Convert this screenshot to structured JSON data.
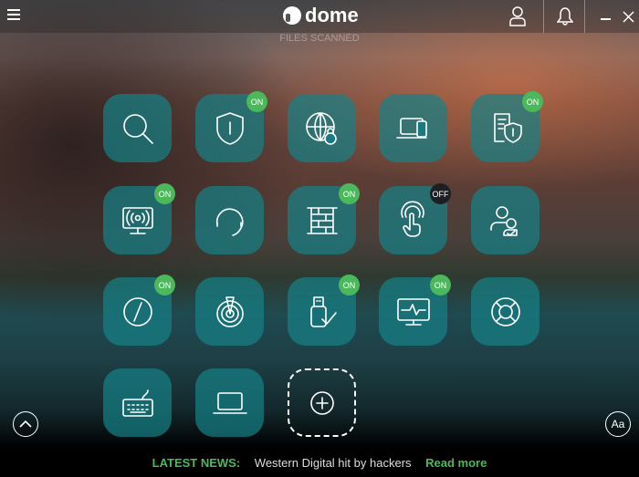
{
  "app": {
    "name": "dome",
    "menu_icon": "hamburger-icon"
  },
  "header": {
    "stats_label": "FILES SCANNED"
  },
  "tiles": [
    {
      "name": "scan",
      "icon": "magnifier-icon",
      "badge": ""
    },
    {
      "name": "antivirus",
      "icon": "shield-icon",
      "badge": "ON"
    },
    {
      "name": "web-protection",
      "icon": "globe-lock-icon",
      "badge": ""
    },
    {
      "name": "devices",
      "icon": "devices-icon",
      "badge": ""
    },
    {
      "name": "data-shield",
      "icon": "document-shield-icon",
      "badge": "ON"
    },
    {
      "name": "wifi-monitor",
      "icon": "monitor-signal-icon",
      "badge": "ON"
    },
    {
      "name": "support",
      "icon": "headset-icon",
      "badge": ""
    },
    {
      "name": "firewall",
      "icon": "brick-wall-icon",
      "badge": "ON"
    },
    {
      "name": "anti-phishing",
      "icon": "touch-icon",
      "badge": "OFF"
    },
    {
      "name": "parental-control",
      "icon": "user-check-icon",
      "badge": ""
    },
    {
      "name": "safe-browsing",
      "icon": "compass-icon",
      "badge": "ON"
    },
    {
      "name": "radar",
      "icon": "radar-icon",
      "badge": ""
    },
    {
      "name": "usb-vaccination",
      "icon": "usb-check-icon",
      "badge": "ON"
    },
    {
      "name": "process-monitor",
      "icon": "monitor-pulse-icon",
      "badge": "ON"
    },
    {
      "name": "rescue",
      "icon": "lifebuoy-icon",
      "badge": ""
    },
    {
      "name": "virtual-keyboard",
      "icon": "keyboard-icon",
      "badge": ""
    },
    {
      "name": "pc-cleanup",
      "icon": "laptop-icon",
      "badge": ""
    },
    {
      "name": "add",
      "icon": "plus-circle-icon",
      "badge": ""
    }
  ],
  "controls": {
    "font_button": "Aa"
  },
  "news": {
    "label": "LATEST NEWS:",
    "headline": "Western Digital hit by hackers",
    "link": "Read more"
  },
  "colors": {
    "accent": "#4cb85c",
    "tile": "#168287",
    "off_badge": "#1c1f24"
  }
}
